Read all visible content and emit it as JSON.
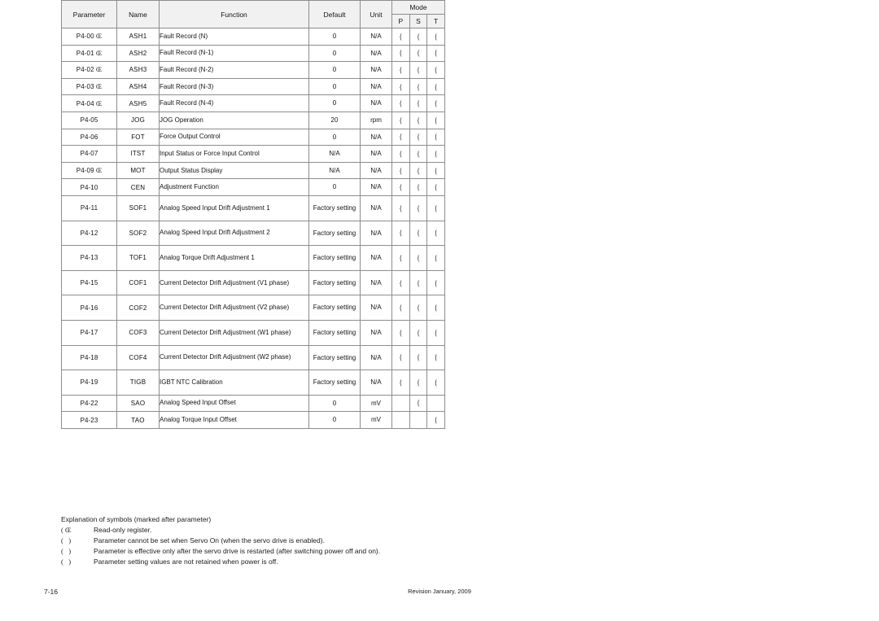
{
  "table": {
    "headers": {
      "parameter": "Parameter",
      "name": "Name",
      "function": "Function",
      "default": "Default",
      "unit": "Unit",
      "mode": "Mode",
      "mode_p": "P",
      "mode_s": "S",
      "mode_t": "T"
    },
    "mark_symbol": "{",
    "readonly_symbol": "Œ",
    "rows": [
      {
        "parameter": "P4-00",
        "readonly": "Œ",
        "name": "ASH1",
        "function": "Fault Record (N)",
        "default": "0",
        "unit": "N/A",
        "p": "{",
        "s": "{",
        "t": "{",
        "lines": 1
      },
      {
        "parameter": "P4-01",
        "readonly": "Œ",
        "name": "ASH2",
        "function": "Fault Record (N-1)",
        "default": "0",
        "unit": "N/A",
        "p": "{",
        "s": "{",
        "t": "{",
        "lines": 1
      },
      {
        "parameter": "P4-02",
        "readonly": "Œ",
        "name": "ASH3",
        "function": "Fault Record (N-2)",
        "default": "0",
        "unit": "N/A",
        "p": "{",
        "s": "{",
        "t": "{",
        "lines": 1
      },
      {
        "parameter": "P4-03",
        "readonly": "Œ",
        "name": "ASH4",
        "function": "Fault Record (N-3)",
        "default": "0",
        "unit": "N/A",
        "p": "{",
        "s": "{",
        "t": "{",
        "lines": 1
      },
      {
        "parameter": "P4-04",
        "readonly": "Œ",
        "name": "ASH5",
        "function": "Fault Record (N-4)",
        "default": "0",
        "unit": "N/A",
        "p": "{",
        "s": "{",
        "t": "{",
        "lines": 1
      },
      {
        "parameter": "P4-05",
        "readonly": "",
        "name": "JOG",
        "function": "JOG Operation",
        "default": "20",
        "unit": "rpm",
        "p": "{",
        "s": "{",
        "t": "{",
        "lines": 1
      },
      {
        "parameter": "P4-06",
        "readonly": "",
        "name": "FOT",
        "function": "Force Output Control",
        "default": "0",
        "unit": "N/A",
        "p": "{",
        "s": "{",
        "t": "{",
        "lines": 1
      },
      {
        "parameter": "P4-07",
        "readonly": "",
        "name": "ITST",
        "function": "Input Status or Force Input Control",
        "default": "N/A",
        "unit": "N/A",
        "p": "{",
        "s": "{",
        "t": "{",
        "lines": 1
      },
      {
        "parameter": "P4-09",
        "readonly": "Œ",
        "name": "MOT",
        "function": "Output Status Display",
        "default": "N/A",
        "unit": "N/A",
        "p": "{",
        "s": "{",
        "t": "{",
        "lines": 1
      },
      {
        "parameter": "P4-10",
        "readonly": "",
        "name": "CEN",
        "function": "Adjustment Function",
        "default": "0",
        "unit": "N/A",
        "p": "{",
        "s": "{",
        "t": "{",
        "lines": 1
      },
      {
        "parameter": "P4-11",
        "readonly": "",
        "name": "SOF1",
        "function": "Analog Speed Input Drift Adjustment 1",
        "default": "Factory setting",
        "unit": "N/A",
        "p": "{",
        "s": "{",
        "t": "{",
        "lines": 2
      },
      {
        "parameter": "P4-12",
        "readonly": "",
        "name": "SOF2",
        "function": "Analog Speed Input Drift Adjustment 2",
        "default": "Factory setting",
        "unit": "N/A",
        "p": "{",
        "s": "{",
        "t": "{",
        "lines": 2
      },
      {
        "parameter": "P4-13",
        "readonly": "",
        "name": "TOF1",
        "function": "Analog Torque Drift Adjustment 1",
        "default": "Factory setting",
        "unit": "N/A",
        "p": "{",
        "s": "{",
        "t": "{",
        "lines": 2
      },
      {
        "parameter": "P4-15",
        "readonly": "",
        "name": "COF1",
        "function": "Current Detector Drift Adjustment (V1 phase)",
        "default": "Factory setting",
        "unit": "N/A",
        "p": "{",
        "s": "{",
        "t": "{",
        "lines": 2
      },
      {
        "parameter": "P4-16",
        "readonly": "",
        "name": "COF2",
        "function": "Current Detector Drift Adjustment (V2 phase)",
        "default": "Factory setting",
        "unit": "N/A",
        "p": "{",
        "s": "{",
        "t": "{",
        "lines": 2
      },
      {
        "parameter": "P4-17",
        "readonly": "",
        "name": "COF3",
        "function": "Current Detector Drift Adjustment (W1 phase)",
        "default": "Factory setting",
        "unit": "N/A",
        "p": "{",
        "s": "{",
        "t": "{",
        "lines": 2
      },
      {
        "parameter": "P4-18",
        "readonly": "",
        "name": "COF4",
        "function": "Current Detector Drift Adjustment (W2 phase)",
        "default": "Factory setting",
        "unit": "N/A",
        "p": "{",
        "s": "{",
        "t": "{",
        "lines": 2
      },
      {
        "parameter": "P4-19",
        "readonly": "",
        "name": "TIGB",
        "function": "IGBT NTC Calibration",
        "default": "Factory setting",
        "unit": "N/A",
        "p": "{",
        "s": "{",
        "t": "{",
        "lines": 2
      },
      {
        "parameter": "P4-22",
        "readonly": "",
        "name": "SAO",
        "function": "Analog Speed Input Offset",
        "default": "0",
        "unit": "mV",
        "p": "",
        "s": "{",
        "t": "",
        "lines": 1
      },
      {
        "parameter": "P4-23",
        "readonly": "",
        "name": "TAO",
        "function": "Analog Torque Input Offset",
        "default": "0",
        "unit": "mV",
        "p": "",
        "s": "",
        "t": "{",
        "lines": 1
      }
    ]
  },
  "footnotes": {
    "title": "Explanation of symbols (marked after parameter)",
    "items": [
      {
        "symbol": "( Œ",
        "text": "Read-only register."
      },
      {
        "symbol": "(   )",
        "text": "Parameter cannot be set when Servo On (when the servo drive is enabled)."
      },
      {
        "symbol": "(   )",
        "text": "Parameter is effective only after the servo drive is restarted (after switching power off and on)."
      },
      {
        "symbol": "(   )",
        "text": "Parameter setting values are not retained when power is off."
      }
    ]
  },
  "page_footer": {
    "page_number": "7-16",
    "revision": "Revision January, 2009"
  }
}
